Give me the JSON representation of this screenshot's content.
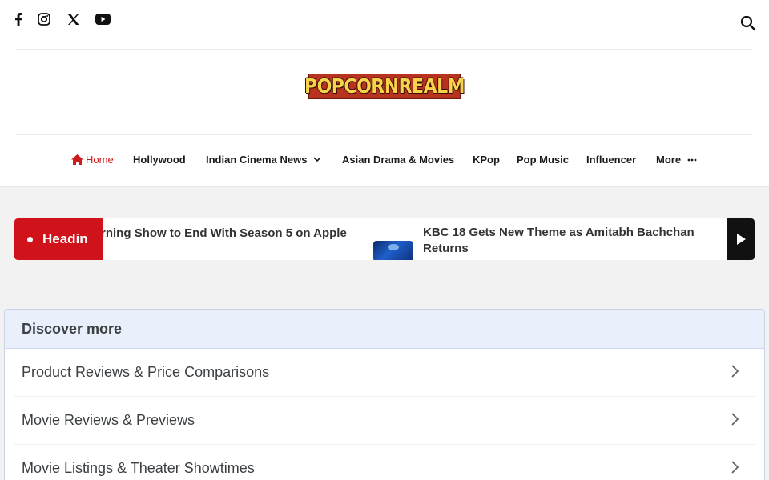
{
  "social": {
    "icons": [
      "facebook-icon",
      "instagram-icon",
      "x-icon",
      "youtube-icon"
    ]
  },
  "logo": {
    "text": "POPCORNREALM"
  },
  "nav": {
    "home": "Home",
    "hollywood": "Hollywood",
    "indian_cinema": "Indian Cinema News",
    "asian_drama": "Asian Drama & Movies",
    "kpop": "KPop",
    "pop_music": "Pop Music",
    "influencer": "Influencer",
    "more": "More"
  },
  "ticker": {
    "label": "Headin",
    "item1": "rning Show to End With Season 5 on Apple",
    "item2": "KBC 18 Gets New Theme as Amitabh Bachchan Returns"
  },
  "discover": {
    "heading": "Discover more",
    "items": [
      "Product Reviews & Price Comparisons",
      "Movie Reviews & Previews",
      "Movie Listings & Theater Showtimes"
    ]
  },
  "colors": {
    "accent_red": "#d0121a",
    "logo_bg": "#b8331f",
    "logo_text": "#f6d34a"
  }
}
